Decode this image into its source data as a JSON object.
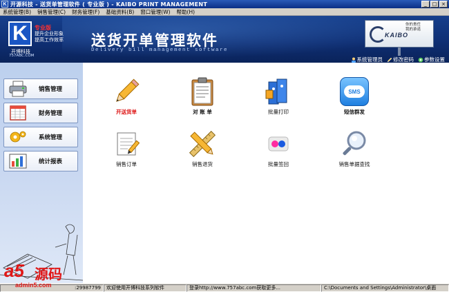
{
  "window": {
    "app_icon_letter": "K",
    "title": "开源科技 - 送货单管理软件 ( 专业版 ) - KAIBO PRINT MANAGEMENT",
    "minimize": "_",
    "maximize": "□",
    "close": "×"
  },
  "menu": {
    "items": [
      "系统管理(B)",
      "销售管理(C)",
      "财务管理(F)",
      "基础资料(B)",
      "窗口管理(W)",
      "帮助(H)"
    ]
  },
  "header": {
    "logo_letter": "K",
    "edition_badge": "专业版",
    "slogan_line1": "提升企业形象",
    "slogan_line2": "提高工作效率",
    "company": "开博科技",
    "company_url": "757ABC.COM",
    "app_title": "送货开单管理软件",
    "app_subtitle": "Delivery bill management software",
    "brand": "KAIBO",
    "brand_slogan_line1": "你的责任",
    "brand_slogan_line2": "我的承诺",
    "links": {
      "admin": "系统管理员",
      "change_password": "修改密码",
      "settings": "参数设置"
    }
  },
  "sidebar": {
    "items": [
      {
        "label": "销售管理",
        "icon": "printer-icon"
      },
      {
        "label": "财务管理",
        "icon": "spreadsheet-icon"
      },
      {
        "label": "系统管理",
        "icon": "gear-icon"
      },
      {
        "label": "统计报表",
        "icon": "bar-chart-icon"
      }
    ]
  },
  "tiles": {
    "row1": [
      {
        "label": "开送货单",
        "icon": "pencil-icon"
      },
      {
        "label": "对 账 单",
        "icon": "clipboard-icon"
      },
      {
        "label": "批量打印",
        "icon": "binders-icon"
      },
      {
        "label": "短信群发",
        "icon": "sms-icon",
        "icon_text": "SMS"
      }
    ],
    "row2": [
      {
        "label": "销售订单",
        "icon": "notepad-icon"
      },
      {
        "label": "销售退货",
        "icon": "ruler-pencil-icon"
      },
      {
        "label": "批量签回",
        "icon": "flickr-dots-icon"
      },
      {
        "label": "销售单据查找",
        "icon": "magnifier-icon"
      }
    ]
  },
  "statusbar": {
    "phone": ":29987799",
    "welcome": "欢迎使用开博科技系列软件",
    "login_info": "登录http://www.757abc.com获取更多...",
    "path": "C:\\Documents and Settings\\Administrator\\桌面"
  },
  "watermark": {
    "a5": "a5",
    "source": "源码",
    "url": "admin5.com"
  },
  "colors": {
    "header_bg": "#0f2f74",
    "sidebar_bg": "#c9d8f1",
    "accent_red": "#d11111",
    "titlebar": "#0b2f86"
  }
}
